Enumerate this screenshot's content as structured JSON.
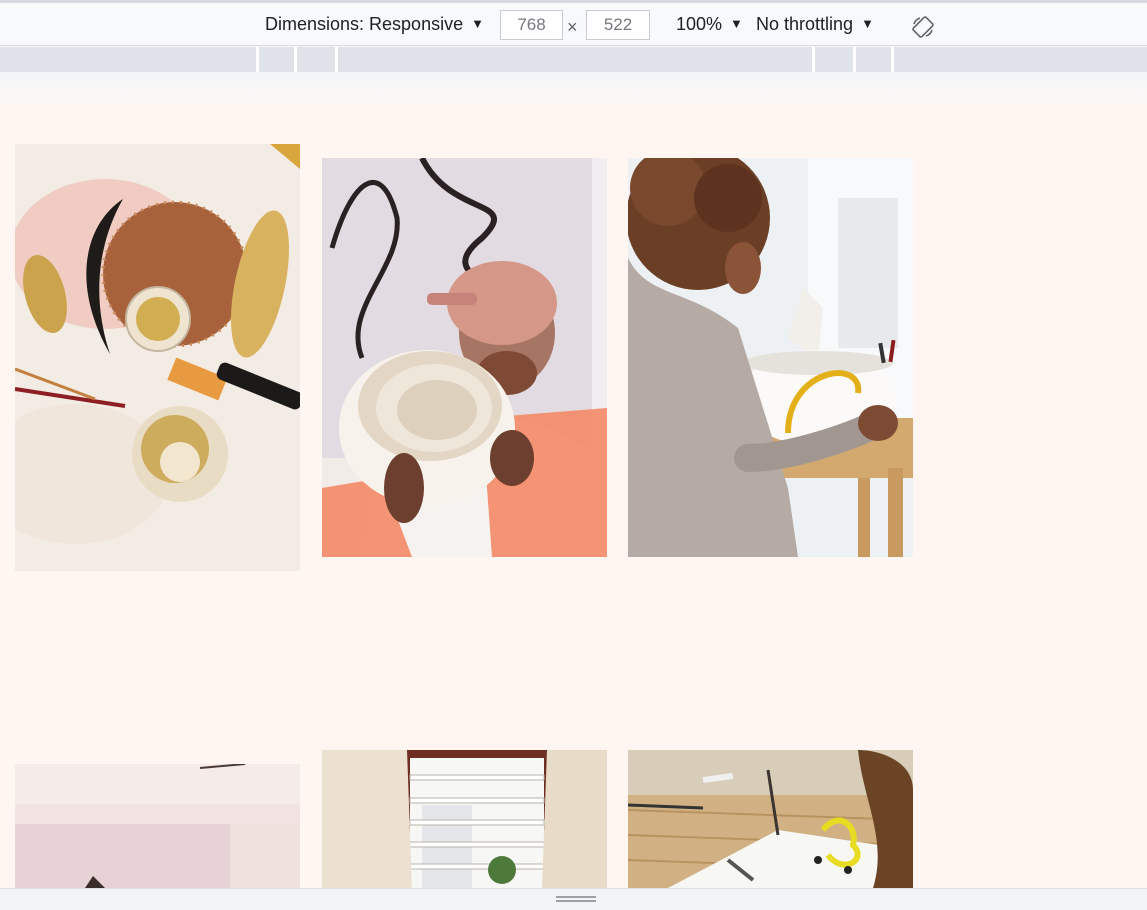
{
  "toolbar": {
    "dimensions_label": "Dimensions: Responsive",
    "width_value": "768",
    "height_value": "522",
    "times_symbol": "×",
    "zoom_label": "100%",
    "throttling_label": "No throttling",
    "caret": "▼"
  },
  "icons": {
    "dropdown": "caret-down-icon",
    "rotate": "rotate-icon",
    "resize": "resize-grip-icon"
  },
  "colors": {
    "page_background": "#fff5f1",
    "toolbar_background": "#f8f9fa",
    "media_query_bar": "#dee1e6"
  }
}
